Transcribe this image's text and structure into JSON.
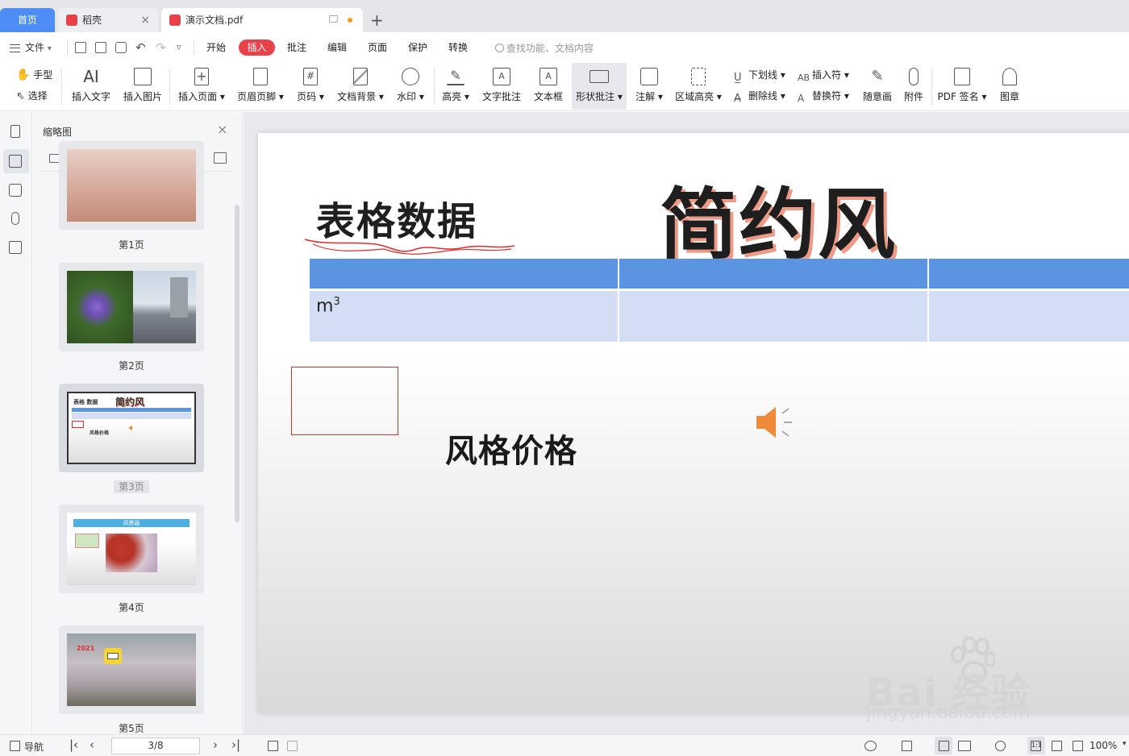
{
  "tabs": {
    "home": "首页",
    "daoke": "稻壳",
    "doc": "演示文档.pdf",
    "close": "×",
    "new": "+"
  },
  "menu": {
    "file": "文件",
    "items": [
      "开始",
      "插入",
      "批注",
      "编辑",
      "页面",
      "保护",
      "转换"
    ],
    "active": "插入",
    "search_placeholder": "查找功能、文档内容"
  },
  "toolbar": {
    "hand": "手型",
    "select": "选择",
    "buttons": [
      "插入文字",
      "插入图片",
      "插入页面",
      "页眉页脚",
      "页码",
      "文档背景",
      "水印",
      "高亮",
      "文字批注",
      "文本框",
      "形状批注",
      "注解",
      "区域高亮"
    ],
    "underline": "下划线",
    "strikethrough": "删除线",
    "insert_mark": "插入符",
    "replace_mark": "替换符",
    "freehand": "随意画",
    "attachment": "附件",
    "pdf_sign": "PDF 签名",
    "stamp": "图章"
  },
  "thumbnails": {
    "title": "缩略图",
    "close": "×",
    "pages": [
      "第1页",
      "第2页",
      "第3页",
      "第4页",
      "第5页"
    ],
    "selected_index": 2,
    "p3_title1": "表格 数据",
    "p3_title2": "简约风",
    "p3_subtitle": "风格价格",
    "p4_title": "风景画",
    "p5_year": "2021"
  },
  "page": {
    "title1": "表格数据",
    "title2": "简约风",
    "subtitle": "风格价格",
    "cell_base": "m",
    "cell_sup": "3"
  },
  "watermark": {
    "main": "Bai 经验",
    "sub": "jingyan.baidu.com"
  },
  "status": {
    "nav": "导航",
    "page": "3/8",
    "zoom": "100%"
  },
  "colors": {
    "accent": "#e8414a",
    "home_tab": "#4d8df5",
    "table_header": "#5b95e2",
    "table_body": "#d3ddf4",
    "title_shadow": "#ef9a86",
    "speaker": "#ee8a3a"
  }
}
